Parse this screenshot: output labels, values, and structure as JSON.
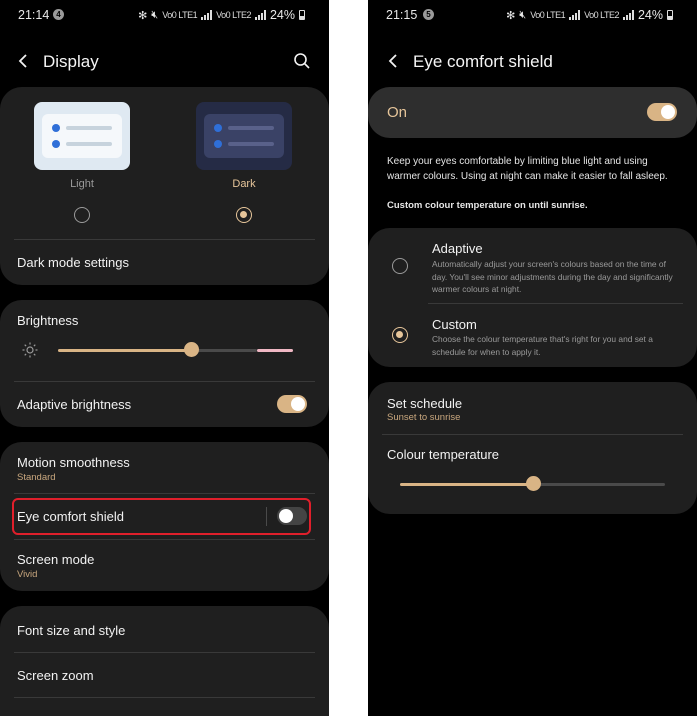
{
  "left_screen": {
    "status_bar": {
      "time": "21:14",
      "notif_badge": "4",
      "network_1": "Vo0 LTE1",
      "network_2": "Vo0 LTE2",
      "battery": "24%"
    },
    "header": {
      "title": "Display"
    },
    "theme": {
      "light_label": "Light",
      "dark_label": "Dark",
      "selected": "Dark",
      "dark_mode_settings": "Dark mode settings"
    },
    "brightness": {
      "label": "Brightness",
      "level": 0.57
    },
    "adaptive_brightness": {
      "label": "Adaptive brightness",
      "on": true
    },
    "motion_smoothness": {
      "label": "Motion smoothness",
      "value": "Standard"
    },
    "eye_comfort_shield": {
      "label": "Eye comfort shield",
      "on": false
    },
    "screen_mode": {
      "label": "Screen mode",
      "value": "Vivid"
    },
    "font_size": {
      "label": "Font size and style"
    },
    "screen_zoom": {
      "label": "Screen zoom"
    }
  },
  "right_screen": {
    "status_bar": {
      "time": "21:15",
      "notif_badge": "5",
      "network_1": "Vo0 LTE1",
      "network_2": "Vo0 LTE2",
      "battery": "24%"
    },
    "header": {
      "title": "Eye comfort shield"
    },
    "master": {
      "label": "On",
      "on": true
    },
    "description": "Keep your eyes comfortable by limiting blue light and using warmer colours. Using at night can make it easier to fall asleep.",
    "custom_note": "Custom colour temperature on until sunrise.",
    "options": {
      "adaptive": {
        "title": "Adaptive",
        "text": "Automatically adjust your screen's colours based on the time of day. You'll see minor adjustments during the day and significantly warmer colours at night.",
        "selected": false
      },
      "custom": {
        "title": "Custom",
        "text": "Choose the colour temperature that's right for you and set a schedule for when to apply it.",
        "selected": true
      }
    },
    "schedule": {
      "label": "Set schedule",
      "value": "Sunset to sunrise"
    },
    "colour_temperature": {
      "label": "Colour temperature",
      "level": 0.5
    }
  },
  "colors": {
    "accent": "#d9b485",
    "highlight": "#e01f2b",
    "card": "#1f1f1f",
    "background": "#000000"
  }
}
